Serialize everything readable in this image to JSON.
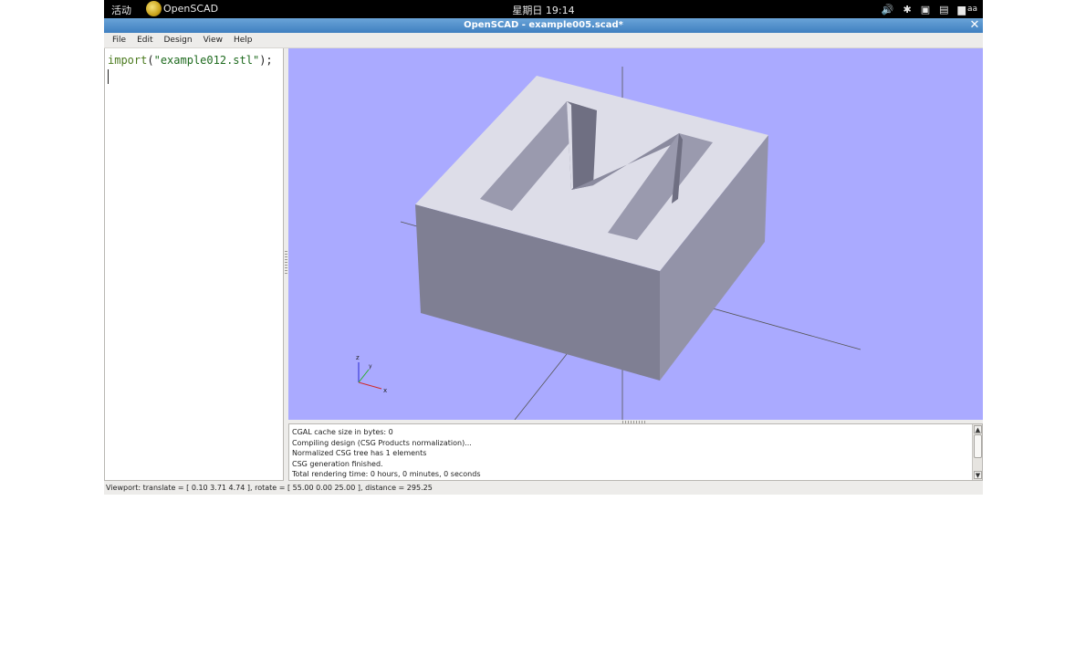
{
  "topbar": {
    "activities": "活动",
    "app_name": "OpenSCAD",
    "clock": "星期日 19:14",
    "tray": [
      {
        "icon": "volume-icon",
        "glyph": "🔊"
      },
      {
        "icon": "bluetooth-icon",
        "glyph": "✱"
      },
      {
        "icon": "network-icon",
        "glyph": "▣"
      },
      {
        "icon": "battery-icon",
        "glyph": "▤"
      },
      {
        "icon": "user-icon",
        "glyph": "▆",
        "label": "aa"
      }
    ]
  },
  "window": {
    "title": "OpenSCAD - example005.scad*",
    "close_glyph": "✕"
  },
  "menu": {
    "file": "File",
    "edit": "Edit",
    "design": "Design",
    "view": "View",
    "help": "Help"
  },
  "editor": {
    "func": "import",
    "open_paren": "(",
    "arg": "\"example012.stl\"",
    "close": ");"
  },
  "viewport": {
    "background": "#aaaaff",
    "axis_labels": {
      "z": "z",
      "y": "y",
      "x": "x"
    }
  },
  "console": {
    "lines": [
      "CGAL cache size in bytes: 0",
      "Compiling design (CSG Products normalization)...",
      "Normalized CSG tree has 1 elements",
      "CSG generation finished.",
      "Total rendering time: 0 hours, 0 minutes, 0 seconds"
    ],
    "scroll_up": "▲",
    "scroll_down": "▼"
  },
  "status": {
    "text": "Viewport: translate = [ 0.10 3.71 4.74 ], rotate = [ 55.00 0.00 25.00 ], distance = 295.25"
  }
}
